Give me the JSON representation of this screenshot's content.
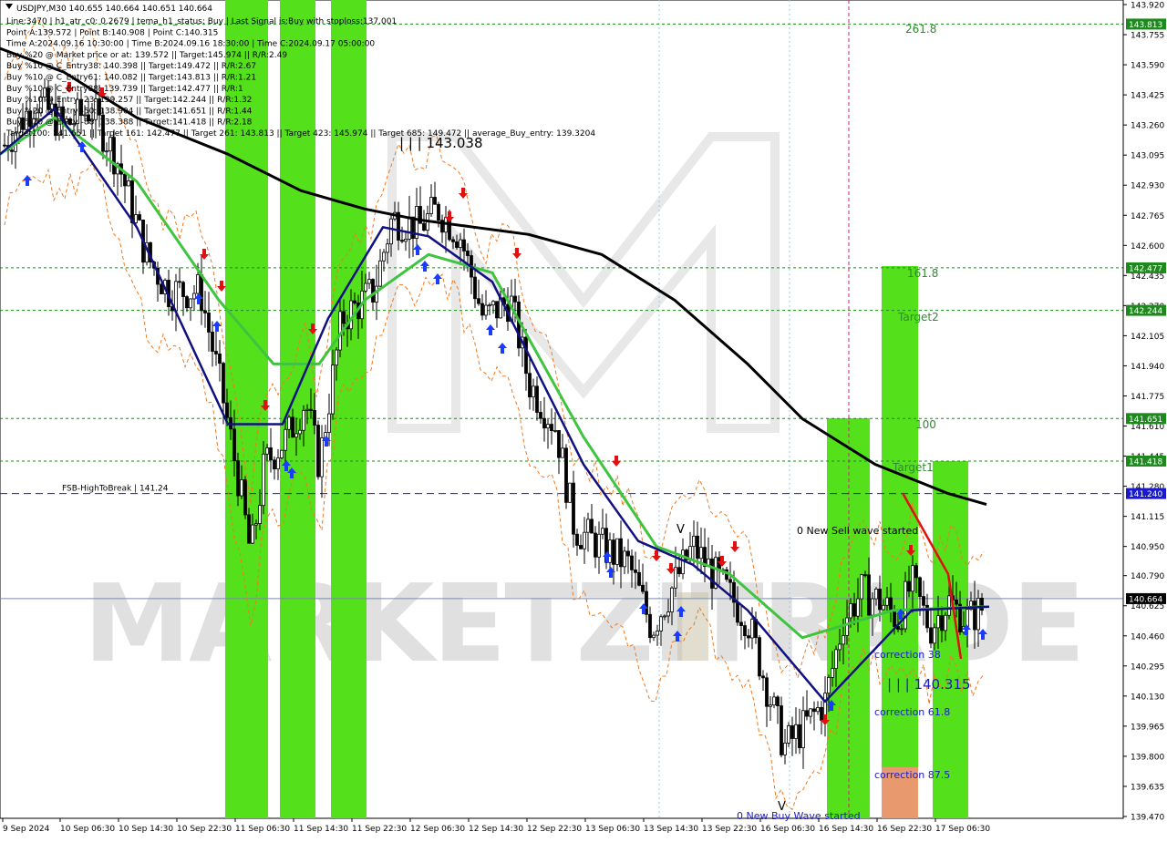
{
  "chart_data": {
    "type": "candlestick",
    "symbol_line": "USDJPY,M30  140.655 140.664 140.651 140.664",
    "info_lines": [
      "Line:3470  |  h1_atr_c0: 0.2679  |  tema_h1_status: Buy  |  Last Signal is:Buy with stoploss:137.001",
      "Point A:139.572  |  Point B:140.908  |  Point C:140.315",
      "Time A:2024.09.16 10:30:00  |  Time B:2024.09.16 18:30:00  |  Time C:2024.09.17 05:00:00",
      "Buy %20 @ Market price or at: 139.572  ||  Target:145.974  ||  R/R:2.49",
      "Buy %10 @ C_Entry38: 140.398  ||  Target:149.472  ||  R/R:2.67",
      "Buy %10 @ C_Entry61: 140.082  ||  Target:143.813  ||  R/R:1.21",
      "Buy %10 @ C_Entry88: 139.739  ||  Target:142.477  ||  R/R:1",
      "Buy %10 @ Entry -23: 139.257  ||  Target:142.244  ||  R/R:1.32",
      "Buy %20 @ Entry -50: 138.904  ||  Target:141.651  ||  R/R:1.44",
      "Buy %20 @ Entry -88: 138.388  ||  Target:141.418  ||  R/R:2.18",
      "Target100: 141.651  ||  Target 161: 142.477  ||  Target 261: 143.813  ||  Target 423: 145.974  ||  Target 685: 149.472  ||  average_Buy_entry: 139.3204"
    ],
    "y_ticks": [
      "143.920",
      "143.755",
      "143.590",
      "143.425",
      "143.260",
      "143.095",
      "142.930",
      "142.765",
      "142.600",
      "142.435",
      "142.270",
      "142.105",
      "141.940",
      "141.775",
      "141.610",
      "141.445",
      "141.280",
      "141.115",
      "140.950",
      "140.790",
      "140.625",
      "140.460",
      "140.295",
      "140.130",
      "139.965",
      "139.800",
      "139.635",
      "139.470"
    ],
    "x_ticks": [
      "9 Sep 2024",
      "10 Sep 06:30",
      "10 Sep 14:30",
      "10 Sep 22:30",
      "11 Sep 06:30",
      "11 Sep 14:30",
      "11 Sep 22:30",
      "12 Sep 06:30",
      "12 Sep 14:30",
      "12 Sep 22:30",
      "13 Sep 06:30",
      "13 Sep 14:30",
      "13 Sep 22:30",
      "16 Sep 06:30",
      "16 Sep 14:30",
      "16 Sep 22:30",
      "17 Sep 06:30"
    ],
    "ylim": [
      139.47,
      143.92
    ],
    "level_lines": [
      {
        "label": "143.813",
        "value": 143.813,
        "color": "#1e8a1e"
      },
      {
        "label": "142.477",
        "value": 142.477,
        "color": "#1e8a1e"
      },
      {
        "label": "142.244",
        "value": 142.244,
        "color": "#1e8a1e"
      },
      {
        "label": "141.651",
        "value": 141.651,
        "color": "#1e8a1e"
      },
      {
        "label": "141.418",
        "value": 141.418,
        "color": "#1e8a1e"
      }
    ],
    "fsb_line": {
      "text": "FSB-HighToBreak | 141.24",
      "value": 141.24,
      "label": "141.240",
      "color": "#1a1acc"
    },
    "price_line": {
      "label": "140.664",
      "value": 140.664
    },
    "fib_labels": [
      "261.8",
      "161.8",
      "Target2",
      "100",
      "Target1"
    ],
    "wave_labels": {
      "sell": "0 New Sell wave started",
      "buy": "0 New Buy Wave started"
    },
    "price_markers": {
      "top": "| | | 143.038",
      "bottom": "| | | 140.315"
    },
    "correction_labels": [
      "correction 38",
      "correction 61.8",
      "correction 87.5"
    ],
    "point_marks": [
      "V",
      "V"
    ],
    "series": [
      {
        "name": "",
        "color": "#000000",
        "values": [
          143.68,
          143.55,
          143.3,
          143.1,
          142.9,
          142.8,
          142.74,
          142.7,
          142.66,
          142.55,
          142.3,
          141.95,
          141.65,
          141.4,
          141.24,
          141.18
        ]
      },
      {
        "name": "",
        "color": "#3ec43e",
        "values": [
          143.1,
          143.3,
          142.95,
          142.3,
          141.95,
          141.95,
          142.3,
          142.55,
          142.45,
          141.55,
          140.95,
          140.8,
          140.45,
          140.6,
          140.62
        ]
      },
      {
        "name": "",
        "color": "#101080",
        "values": [
          143.1,
          143.35,
          142.7,
          141.62,
          141.62,
          142.2,
          142.7,
          142.65,
          142.4,
          141.4,
          140.98,
          140.85,
          140.6,
          140.1,
          140.6,
          140.62
        ]
      }
    ],
    "colors": {
      "green_band": "#55e01c",
      "orange_box": "#e89a6e",
      "signal_up": "#1a3cff",
      "signal_down": "#e01010",
      "watermark": "#cfcfcf"
    },
    "watermark_text": "MARKETZITRADE"
  }
}
